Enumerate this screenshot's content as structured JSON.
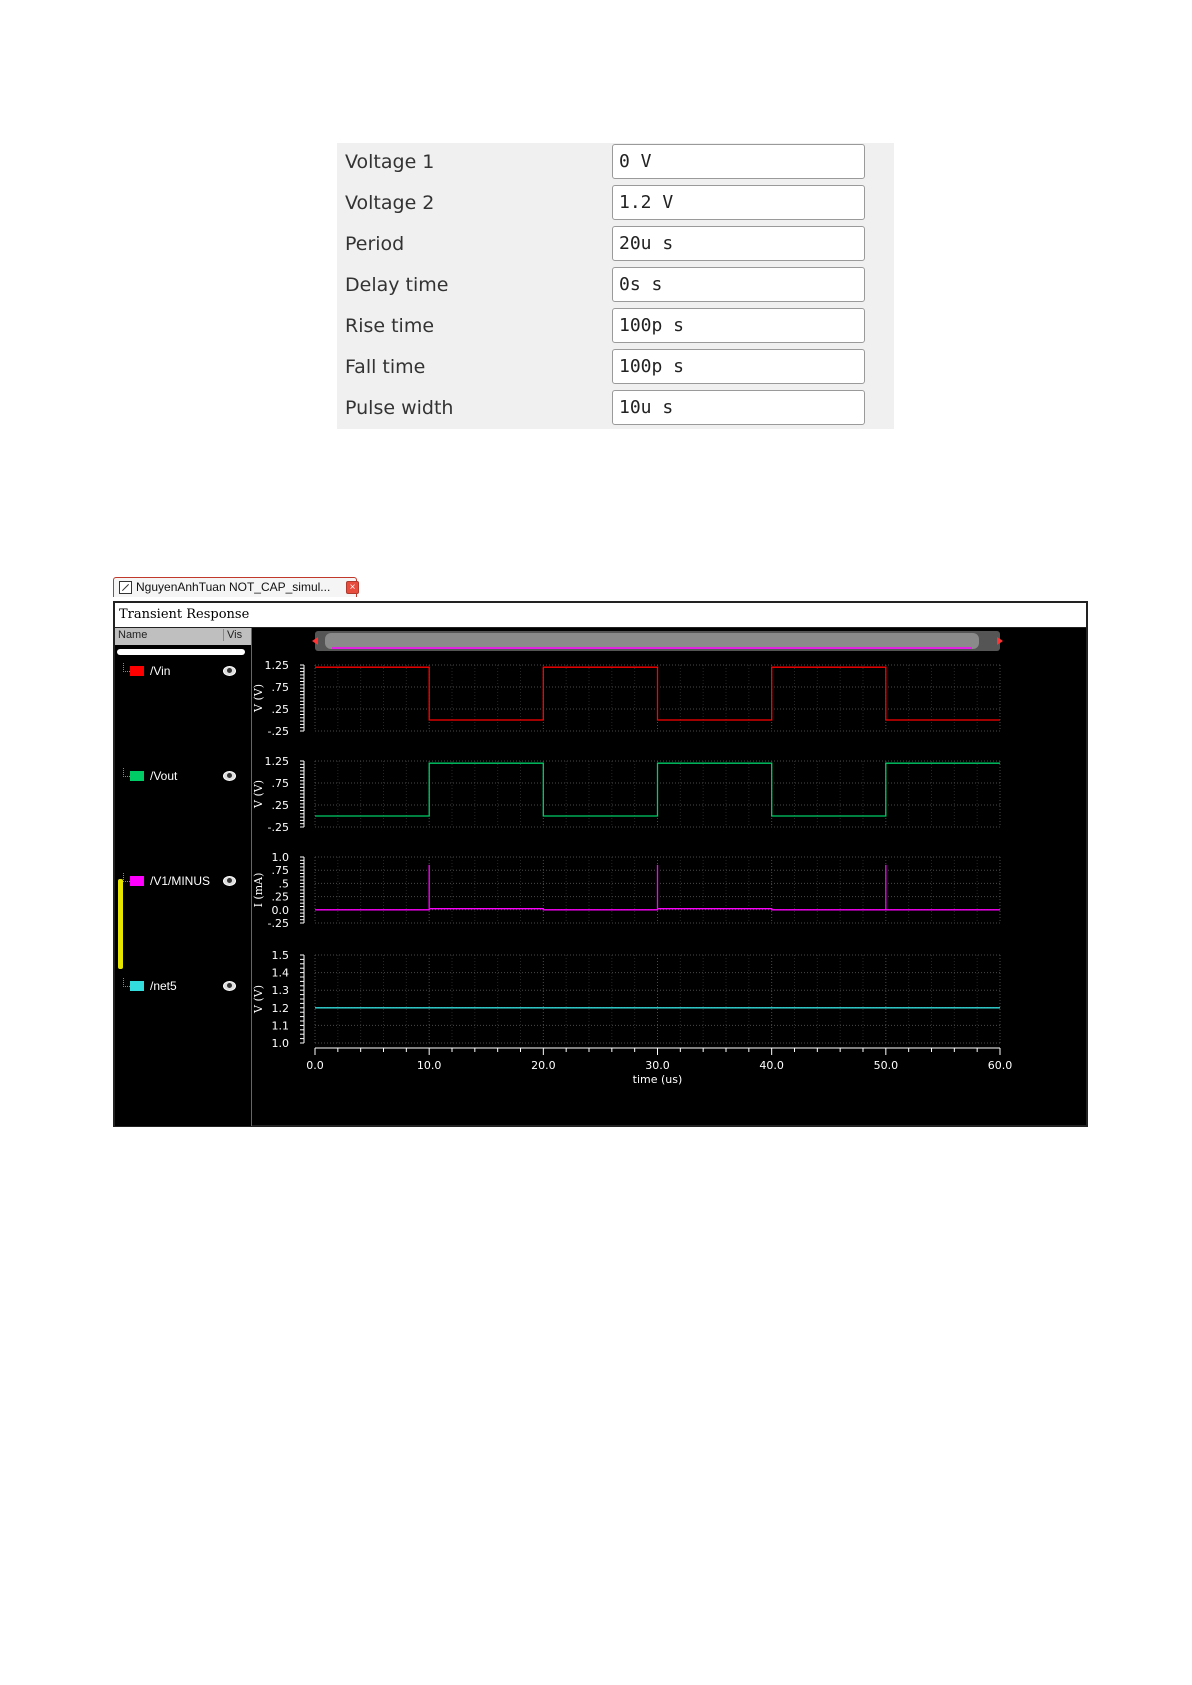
{
  "form": {
    "rows": [
      {
        "label": "Voltage 1",
        "value": "0 V"
      },
      {
        "label": "Voltage 2",
        "value": "1.2 V"
      },
      {
        "label": "Period",
        "value": "20u s"
      },
      {
        "label": "Delay time",
        "value": "0s s"
      },
      {
        "label": "Rise time",
        "value": "100p s"
      },
      {
        "label": "Fall time",
        "value": "100p s"
      },
      {
        "label": "Pulse width",
        "value": "10u s"
      }
    ]
  },
  "window": {
    "tab_title": "NguyenAnhTuan NOT_CAP_simul...",
    "title": "Transient Response",
    "legend_headers": {
      "name": "Name",
      "vis": "Vis"
    }
  },
  "signals": [
    {
      "name": "/Vin",
      "color": "#ff0000"
    },
    {
      "name": "/Vout",
      "color": "#00cc66"
    },
    {
      "name": "/V1/MINUS",
      "color": "#ff00ff"
    },
    {
      "name": "/net5",
      "color": "#33dddd"
    }
  ],
  "chart_data": {
    "type": "line",
    "xlabel": "time (us)",
    "xlim": [
      0,
      60
    ],
    "xticks": [
      "0.0",
      "10.0",
      "20.0",
      "30.0",
      "40.0",
      "50.0",
      "60.0"
    ],
    "grid": true,
    "strips": [
      {
        "name": "/Vin",
        "ylabel": "V (V)",
        "ylim": [
          -0.25,
          1.25
        ],
        "yticks": [
          "1.25",
          ".75",
          ".25",
          "-.25"
        ],
        "color": "#ff0000",
        "x": [
          0,
          10,
          10,
          20,
          20,
          30,
          30,
          40,
          40,
          50,
          50,
          60
        ],
        "y": [
          1.2,
          1.2,
          0,
          0,
          1.2,
          1.2,
          0,
          0,
          1.2,
          1.2,
          0,
          0
        ]
      },
      {
        "name": "/Vout",
        "ylabel": "V (V)",
        "ylim": [
          -0.25,
          1.25
        ],
        "yticks": [
          "1.25",
          ".75",
          ".25",
          "-.25"
        ],
        "color": "#00cc66",
        "x": [
          0,
          10,
          10,
          20,
          20,
          30,
          30,
          40,
          40,
          50,
          50,
          60
        ],
        "y": [
          0,
          0,
          1.2,
          1.2,
          0,
          0,
          1.2,
          1.2,
          0,
          0,
          1.2,
          1.2
        ]
      },
      {
        "name": "/V1/MINUS",
        "ylabel": "I (mA)",
        "ylim": [
          -0.25,
          1.0
        ],
        "yticks": [
          "1.0",
          ".75",
          ".5",
          ".25",
          "0.0",
          "-.25"
        ],
        "color": "#ff00ff",
        "x": [
          0,
          10,
          10,
          10,
          20,
          20,
          20,
          30,
          30,
          30,
          40,
          40,
          40,
          50,
          50,
          50,
          60
        ],
        "y": [
          0,
          0,
          0.85,
          0.02,
          0.02,
          0,
          0,
          0,
          0.85,
          0.02,
          0.02,
          0,
          0,
          0,
          0.85,
          0,
          0
        ]
      },
      {
        "name": "/net5",
        "ylabel": "V (V)",
        "ylim": [
          1.0,
          1.5
        ],
        "yticks": [
          "1.5",
          "1.4",
          "1.3",
          "1.2",
          "1.1",
          "1.0"
        ],
        "color": "#33dddd",
        "x": [
          0,
          60
        ],
        "y": [
          1.2,
          1.2
        ]
      }
    ]
  }
}
